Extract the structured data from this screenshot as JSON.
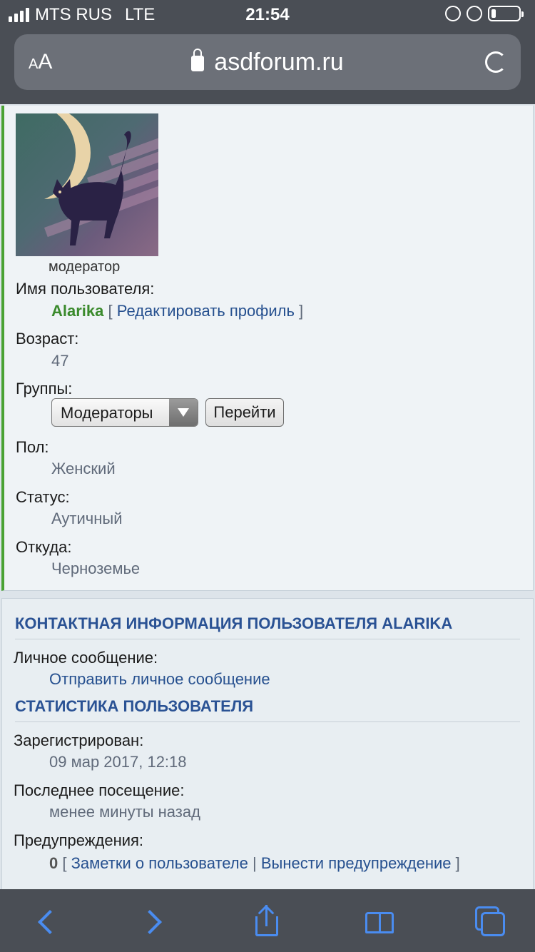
{
  "status_bar": {
    "carrier": "MTS RUS",
    "network": "LTE",
    "time": "21:54"
  },
  "browser": {
    "text_size_label": "AA",
    "url": "asdforum.ru"
  },
  "profile": {
    "rank": "модератор",
    "username_label": "Имя пользователя:",
    "username": "Alarika",
    "edit_open": "[",
    "edit_profile_link": "Редактировать профиль",
    "edit_close": "]",
    "age_label": "Возраст:",
    "age": "47",
    "groups_label": "Группы:",
    "groups_selected": "Модераторы",
    "go_button": "Перейти",
    "gender_label": "Пол:",
    "gender": "Женский",
    "status_label": "Статус:",
    "status": "Аутичный",
    "location_label": "Откуда:",
    "location": "Черноземье"
  },
  "contact": {
    "title": "КОНТАКТНАЯ ИНФОРМАЦИЯ ПОЛЬЗОВАТЕЛЯ ALARIKA",
    "pm_label": "Личное сообщение:",
    "pm_link": "Отправить личное сообщение"
  },
  "stats": {
    "title": "СТАТИСТИКА ПОЛЬЗОВАТЕЛЯ",
    "registered_label": "Зарегистрирован:",
    "registered": "09 мар 2017, 12:18",
    "last_visit_label": "Последнее посещение:",
    "last_visit": "менее минуты назад",
    "warnings_label": "Предупреждения:",
    "warnings_count": "0",
    "warnings_open": "[",
    "notes_link": "Заметки о пользователе",
    "separator": "|",
    "warn_link": "Вынести предупреждение",
    "warnings_close": "]"
  },
  "colors": {
    "accent_green": "#4aa233",
    "link_blue": "#26508f",
    "toolbar_blue": "#4a8cf0"
  }
}
